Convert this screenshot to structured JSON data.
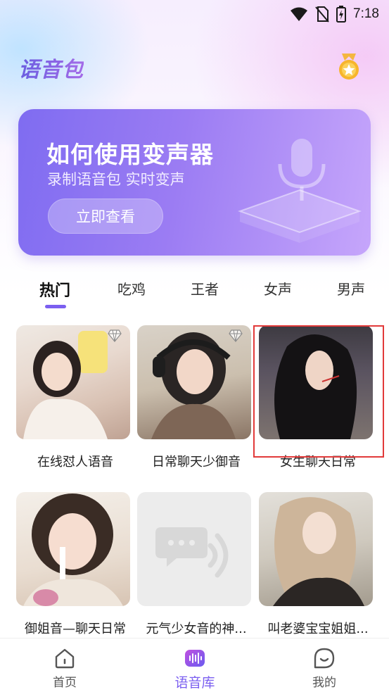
{
  "status_bar": {
    "time": "7:18",
    "icons": [
      "wifi-icon",
      "no-sim-icon",
      "battery-charging-icon"
    ]
  },
  "header": {
    "title": "语音包",
    "medal_icon": "medal-star-icon"
  },
  "banner": {
    "title": "如何使用变声器",
    "subtitle": "录制语音包 实时变声",
    "button_label": "立即查看",
    "illustration_icon": "microphone-icon"
  },
  "tabs": [
    {
      "label": "热门",
      "active": true
    },
    {
      "label": "吃鸡",
      "active": false
    },
    {
      "label": "王者",
      "active": false
    },
    {
      "label": "女声",
      "active": false
    },
    {
      "label": "男声",
      "active": false
    }
  ],
  "voice_packs": [
    {
      "title": "在线怼人语音",
      "premium": true
    },
    {
      "title": "日常聊天少御音",
      "premium": true
    },
    {
      "title": "女生聊天日常",
      "premium": false
    },
    {
      "title": "御姐音—聊天日常",
      "premium": false
    },
    {
      "title": "元气少女音的神...",
      "premium": false
    },
    {
      "title": "叫老婆宝宝姐姐...",
      "premium": false
    }
  ],
  "bottom_nav": [
    {
      "label": "首页",
      "icon": "home-icon",
      "active": false
    },
    {
      "label": "语音库",
      "icon": "voice-library-icon",
      "active": true
    },
    {
      "label": "我的",
      "icon": "profile-icon",
      "active": false
    }
  ],
  "colors": {
    "accent": "#7b5ff0",
    "banner_start": "#7f6cf1",
    "banner_end": "#c6a6fb",
    "highlight": "#e23a3a"
  }
}
